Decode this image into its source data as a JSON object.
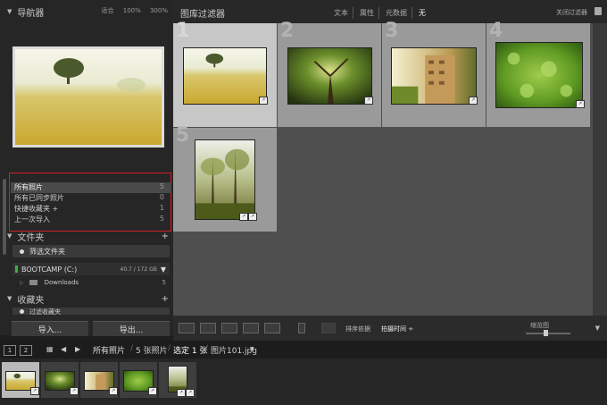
{
  "navigator": {
    "title": "导航器",
    "zoom_options": "适合 100% 300%"
  },
  "catalog": {
    "items": [
      {
        "label": "所有照片",
        "count": "5"
      },
      {
        "label": "所有已同步照片",
        "count": "0"
      },
      {
        "label": "快捷收藏夹 +",
        "count": "1"
      },
      {
        "label": "上一次导入",
        "count": "5"
      }
    ]
  },
  "folders": {
    "title": "文件夹",
    "filter_placeholder": "筛选文件夹",
    "volume": {
      "name": "BOOTCAMP (C:)",
      "capacity": "40.7 / 172 GB"
    },
    "items": [
      {
        "label": "Downloads",
        "count": "5"
      }
    ]
  },
  "collections": {
    "title": "收藏夹",
    "filter_placeholder": "过滤收藏夹"
  },
  "buttons": {
    "import": "导入...",
    "export": "导出..."
  },
  "filter_bar": {
    "title": "图库过滤器",
    "tabs": [
      "文本",
      "属性",
      "元数据",
      "无"
    ],
    "active_tab": "无",
    "close_label": "关闭过滤器"
  },
  "grid": {
    "cells": [
      {
        "num": "1",
        "selected": true,
        "icon": "meadow-tree-photo"
      },
      {
        "num": "2",
        "selected": false,
        "icon": "forest-tree-photo"
      },
      {
        "num": "3",
        "selected": false,
        "icon": "building-photo"
      },
      {
        "num": "4",
        "selected": false,
        "icon": "green-leaves-photo"
      },
      {
        "num": "5",
        "selected": false,
        "icon": "tall-trees-photo"
      }
    ]
  },
  "toolbar": {
    "sort_label": "排序依据",
    "sort_value": "拍摄时间 ÷",
    "thumbnail_label": "缩览图",
    "thumbnail_size_fraction": 0.45
  },
  "filmstrip_bar": {
    "pages": [
      "1",
      "2"
    ],
    "source": "所有照片",
    "count_text": "5 张照片",
    "selection_text": "选定 1 张",
    "filename": "图片101.jpg"
  },
  "colors": {
    "highlight_box": "#d0202a",
    "accent_green": "#3fae3f"
  }
}
